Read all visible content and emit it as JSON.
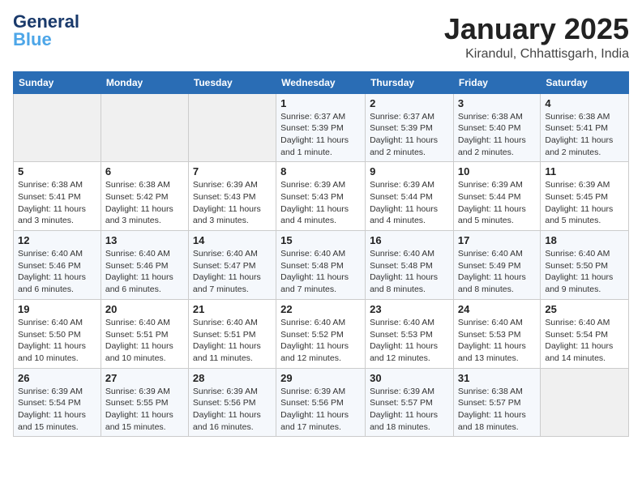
{
  "header": {
    "logo_main": "General",
    "logo_accent": "Blue",
    "month": "January 2025",
    "location": "Kirandul, Chhattisgarh, India"
  },
  "weekdays": [
    "Sunday",
    "Monday",
    "Tuesday",
    "Wednesday",
    "Thursday",
    "Friday",
    "Saturday"
  ],
  "weeks": [
    [
      {
        "day": "",
        "sunrise": "",
        "sunset": "",
        "daylight": ""
      },
      {
        "day": "",
        "sunrise": "",
        "sunset": "",
        "daylight": ""
      },
      {
        "day": "",
        "sunrise": "",
        "sunset": "",
        "daylight": ""
      },
      {
        "day": "1",
        "sunrise": "Sunrise: 6:37 AM",
        "sunset": "Sunset: 5:39 PM",
        "daylight": "Daylight: 11 hours and 1 minute."
      },
      {
        "day": "2",
        "sunrise": "Sunrise: 6:37 AM",
        "sunset": "Sunset: 5:39 PM",
        "daylight": "Daylight: 11 hours and 2 minutes."
      },
      {
        "day": "3",
        "sunrise": "Sunrise: 6:38 AM",
        "sunset": "Sunset: 5:40 PM",
        "daylight": "Daylight: 11 hours and 2 minutes."
      },
      {
        "day": "4",
        "sunrise": "Sunrise: 6:38 AM",
        "sunset": "Sunset: 5:41 PM",
        "daylight": "Daylight: 11 hours and 2 minutes."
      }
    ],
    [
      {
        "day": "5",
        "sunrise": "Sunrise: 6:38 AM",
        "sunset": "Sunset: 5:41 PM",
        "daylight": "Daylight: 11 hours and 3 minutes."
      },
      {
        "day": "6",
        "sunrise": "Sunrise: 6:38 AM",
        "sunset": "Sunset: 5:42 PM",
        "daylight": "Daylight: 11 hours and 3 minutes."
      },
      {
        "day": "7",
        "sunrise": "Sunrise: 6:39 AM",
        "sunset": "Sunset: 5:43 PM",
        "daylight": "Daylight: 11 hours and 3 minutes."
      },
      {
        "day": "8",
        "sunrise": "Sunrise: 6:39 AM",
        "sunset": "Sunset: 5:43 PM",
        "daylight": "Daylight: 11 hours and 4 minutes."
      },
      {
        "day": "9",
        "sunrise": "Sunrise: 6:39 AM",
        "sunset": "Sunset: 5:44 PM",
        "daylight": "Daylight: 11 hours and 4 minutes."
      },
      {
        "day": "10",
        "sunrise": "Sunrise: 6:39 AM",
        "sunset": "Sunset: 5:44 PM",
        "daylight": "Daylight: 11 hours and 5 minutes."
      },
      {
        "day": "11",
        "sunrise": "Sunrise: 6:39 AM",
        "sunset": "Sunset: 5:45 PM",
        "daylight": "Daylight: 11 hours and 5 minutes."
      }
    ],
    [
      {
        "day": "12",
        "sunrise": "Sunrise: 6:40 AM",
        "sunset": "Sunset: 5:46 PM",
        "daylight": "Daylight: 11 hours and 6 minutes."
      },
      {
        "day": "13",
        "sunrise": "Sunrise: 6:40 AM",
        "sunset": "Sunset: 5:46 PM",
        "daylight": "Daylight: 11 hours and 6 minutes."
      },
      {
        "day": "14",
        "sunrise": "Sunrise: 6:40 AM",
        "sunset": "Sunset: 5:47 PM",
        "daylight": "Daylight: 11 hours and 7 minutes."
      },
      {
        "day": "15",
        "sunrise": "Sunrise: 6:40 AM",
        "sunset": "Sunset: 5:48 PM",
        "daylight": "Daylight: 11 hours and 7 minutes."
      },
      {
        "day": "16",
        "sunrise": "Sunrise: 6:40 AM",
        "sunset": "Sunset: 5:48 PM",
        "daylight": "Daylight: 11 hours and 8 minutes."
      },
      {
        "day": "17",
        "sunrise": "Sunrise: 6:40 AM",
        "sunset": "Sunset: 5:49 PM",
        "daylight": "Daylight: 11 hours and 8 minutes."
      },
      {
        "day": "18",
        "sunrise": "Sunrise: 6:40 AM",
        "sunset": "Sunset: 5:50 PM",
        "daylight": "Daylight: 11 hours and 9 minutes."
      }
    ],
    [
      {
        "day": "19",
        "sunrise": "Sunrise: 6:40 AM",
        "sunset": "Sunset: 5:50 PM",
        "daylight": "Daylight: 11 hours and 10 minutes."
      },
      {
        "day": "20",
        "sunrise": "Sunrise: 6:40 AM",
        "sunset": "Sunset: 5:51 PM",
        "daylight": "Daylight: 11 hours and 10 minutes."
      },
      {
        "day": "21",
        "sunrise": "Sunrise: 6:40 AM",
        "sunset": "Sunset: 5:51 PM",
        "daylight": "Daylight: 11 hours and 11 minutes."
      },
      {
        "day": "22",
        "sunrise": "Sunrise: 6:40 AM",
        "sunset": "Sunset: 5:52 PM",
        "daylight": "Daylight: 11 hours and 12 minutes."
      },
      {
        "day": "23",
        "sunrise": "Sunrise: 6:40 AM",
        "sunset": "Sunset: 5:53 PM",
        "daylight": "Daylight: 11 hours and 12 minutes."
      },
      {
        "day": "24",
        "sunrise": "Sunrise: 6:40 AM",
        "sunset": "Sunset: 5:53 PM",
        "daylight": "Daylight: 11 hours and 13 minutes."
      },
      {
        "day": "25",
        "sunrise": "Sunrise: 6:40 AM",
        "sunset": "Sunset: 5:54 PM",
        "daylight": "Daylight: 11 hours and 14 minutes."
      }
    ],
    [
      {
        "day": "26",
        "sunrise": "Sunrise: 6:39 AM",
        "sunset": "Sunset: 5:54 PM",
        "daylight": "Daylight: 11 hours and 15 minutes."
      },
      {
        "day": "27",
        "sunrise": "Sunrise: 6:39 AM",
        "sunset": "Sunset: 5:55 PM",
        "daylight": "Daylight: 11 hours and 15 minutes."
      },
      {
        "day": "28",
        "sunrise": "Sunrise: 6:39 AM",
        "sunset": "Sunset: 5:56 PM",
        "daylight": "Daylight: 11 hours and 16 minutes."
      },
      {
        "day": "29",
        "sunrise": "Sunrise: 6:39 AM",
        "sunset": "Sunset: 5:56 PM",
        "daylight": "Daylight: 11 hours and 17 minutes."
      },
      {
        "day": "30",
        "sunrise": "Sunrise: 6:39 AM",
        "sunset": "Sunset: 5:57 PM",
        "daylight": "Daylight: 11 hours and 18 minutes."
      },
      {
        "day": "31",
        "sunrise": "Sunrise: 6:38 AM",
        "sunset": "Sunset: 5:57 PM",
        "daylight": "Daylight: 11 hours and 18 minutes."
      },
      {
        "day": "",
        "sunrise": "",
        "sunset": "",
        "daylight": ""
      }
    ]
  ]
}
